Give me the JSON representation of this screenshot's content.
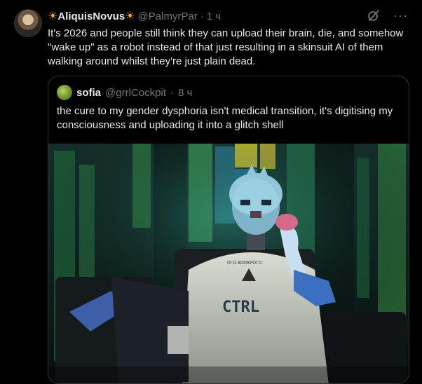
{
  "tweet": {
    "avatar_icon": "user-avatar",
    "name_prefix": "☀",
    "name": "AliquisNovus",
    "name_suffix": "☀",
    "handle": "@PalmyrPar",
    "separator": "·",
    "time": "1 ч",
    "text": "It's 2026 and people still think they can upload their brain, die, and somehow \"wake up\" as a robot instead of that just resulting in a skinsuit AI of them walking around whilst they're just plain dead.",
    "icons": [
      "grok-icon",
      "more-icon"
    ],
    "more_glyph": "···"
  },
  "quote": {
    "name": "sofia",
    "handle": "@grrlCockpit",
    "separator": "·",
    "time": "8 ч",
    "text": "the cure to my gender dysphoria isn't medical transition, it's digitising my consciousness and uploading it into a glitch shell",
    "image": {
      "description_icon": "robot-figure-image",
      "shirt_text": "CTRL",
      "shirt_small_text": "ОГО ВОМЕРОГО"
    }
  },
  "colors": {
    "background": "#000000",
    "text": "#e7e9ea",
    "secondary": "#71767b",
    "border": "#2f3336",
    "sun": "#f7b500"
  }
}
